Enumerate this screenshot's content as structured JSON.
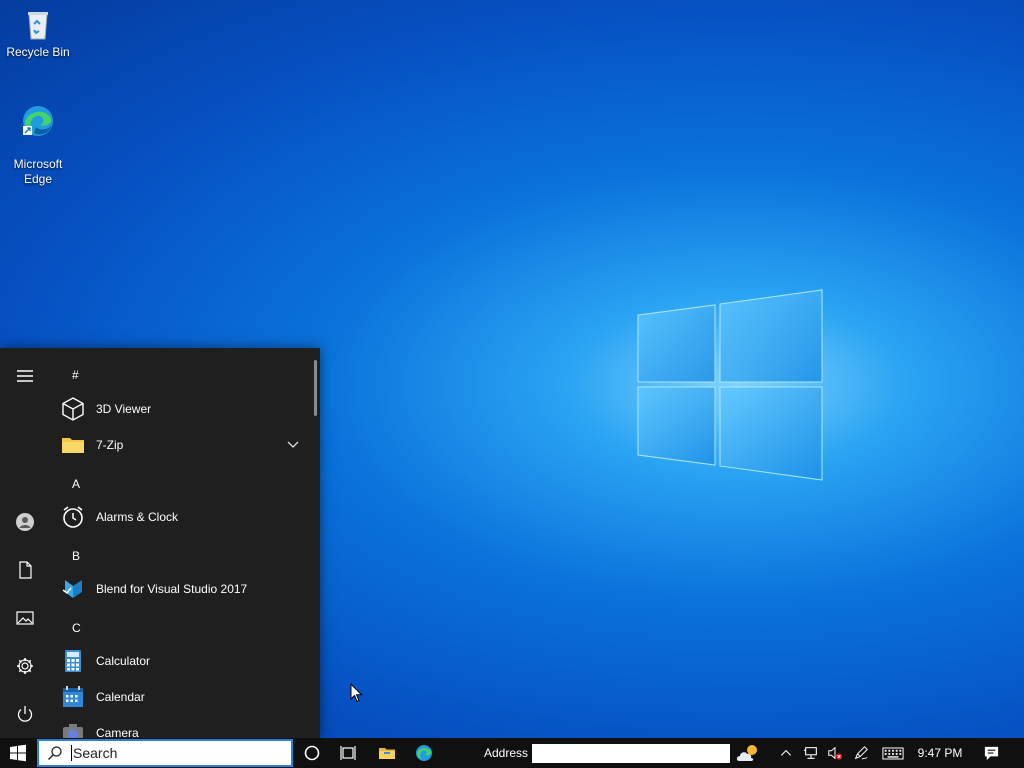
{
  "desktop": {
    "icons": [
      {
        "label": "Recycle Bin",
        "icon": "recycle-bin-icon"
      },
      {
        "label": "Microsoft\nEdge",
        "icon": "edge-icon"
      }
    ]
  },
  "start_menu": {
    "rail": [
      "hamburger-icon",
      "user-icon",
      "documents-icon",
      "pictures-icon",
      "settings-icon",
      "power-icon"
    ],
    "groups": {
      "hash": "#",
      "a": "A",
      "b": "B",
      "c": "C"
    },
    "apps": [
      {
        "label": "3D Viewer",
        "icon": "cube-icon"
      },
      {
        "label": "7-Zip",
        "icon": "folder-icon"
      },
      {
        "label": "Alarms & Clock",
        "icon": "alarm-clock-icon"
      },
      {
        "label": "Blend for Visual Studio 2017",
        "icon": "blend-icon"
      },
      {
        "label": "Calculator",
        "icon": "calculator-icon"
      },
      {
        "label": "Calendar",
        "icon": "calendar-icon"
      },
      {
        "label": "Camera",
        "icon": "camera-icon"
      }
    ]
  },
  "taskbar": {
    "search_placeholder": "Search",
    "address_label": "Address",
    "address_value": "",
    "clock": "9:47 PM",
    "colors": {
      "bar": "#101010",
      "search_border": "#2a7fd6",
      "menu": "#1f1f1f"
    }
  }
}
